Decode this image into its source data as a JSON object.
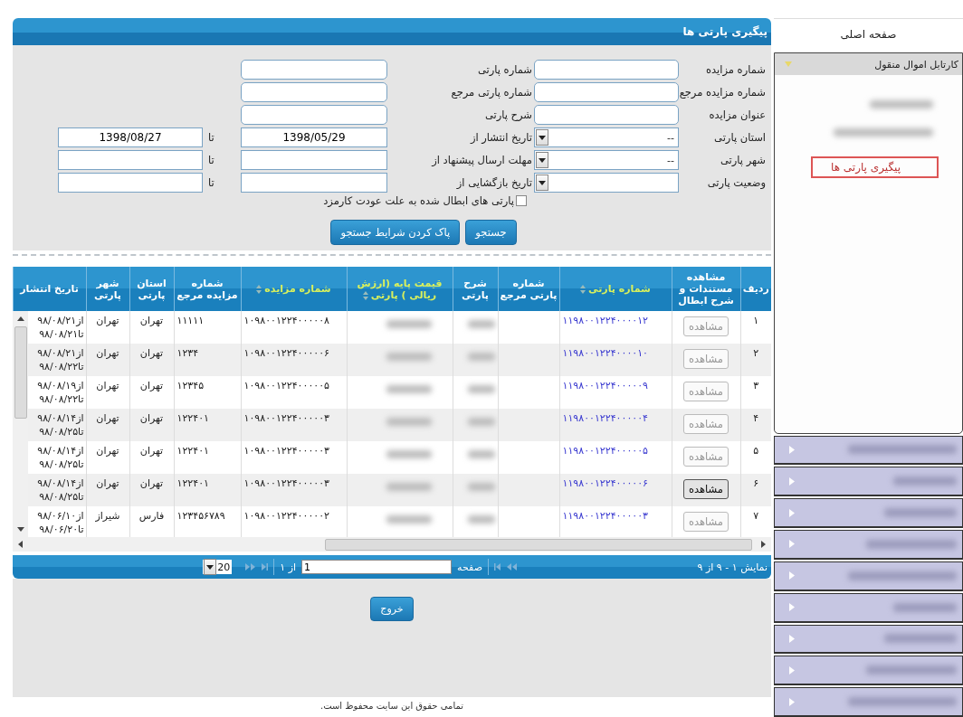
{
  "sidebar": {
    "home": "صفحه اصلی",
    "panel": {
      "title": "کارتابل اموال منقول",
      "expanded": true,
      "items": [
        {
          "kind": "blurred",
          "selected": false
        },
        {
          "kind": "blurred",
          "selected": false
        },
        {
          "kind": "link",
          "label": "پیگیری پارتی ها",
          "selected": true
        }
      ]
    },
    "collapsed_panels": [
      {
        "expanded": false
      },
      {
        "expanded": false
      },
      {
        "expanded": false
      },
      {
        "expanded": false
      },
      {
        "expanded": false
      },
      {
        "expanded": false
      },
      {
        "expanded": false
      },
      {
        "expanded": false
      },
      {
        "expanded": false
      }
    ]
  },
  "panel_title": "پیگیری پارتی ها",
  "form": {
    "column_1": [
      {
        "kind": "text",
        "label": "شماره مزایده"
      },
      {
        "kind": "text",
        "label": "شماره مزایده مرجع"
      },
      {
        "kind": "text",
        "label": "عنوان مزایده"
      },
      {
        "kind": "select",
        "label": "استان پارتی",
        "value": "--"
      },
      {
        "kind": "select",
        "label": "شهر پارتی",
        "value": "--"
      },
      {
        "kind": "select",
        "label": "وضعیت پارتی"
      }
    ],
    "column_2": [
      {
        "kind": "text",
        "label": "شماره پارتی"
      },
      {
        "kind": "text",
        "label": "شماره پارتی مرجع"
      },
      {
        "kind": "text",
        "label": "شرح پارتی"
      },
      {
        "kind": "range",
        "label": "تاریخ انتشار از",
        "from": "1398/05/29",
        "to_label": "تا",
        "to": "1398/08/27"
      },
      {
        "kind": "range",
        "label": "مهلت ارسال پیشنهاد از",
        "to_label": "تا"
      },
      {
        "kind": "range",
        "label": "تاریخ بازگشایی از",
        "to_label": "تا"
      }
    ],
    "checkbox": {
      "label": "پارتی های ابطال شده به علت عودت کارمزد",
      "checked": false
    },
    "buttons": [
      "جستجو",
      "پاک کردن شرایط جستجو"
    ]
  },
  "table": {
    "columns": [
      {
        "label": "ردیف",
        "sortable": false
      },
      {
        "label": "مشاهده مستندات و شرح ابطال",
        "sortable": false
      },
      {
        "label": "شماره پارتی",
        "sortable": true
      },
      {
        "label": "شماره پارتی مرجع",
        "sortable": false
      },
      {
        "label": "شرح پارتی",
        "sortable": false
      },
      {
        "label": "قیمت پایه (ارزش ریالی ) پارتی",
        "sortable": true
      },
      {
        "label": "شماره مزایده",
        "sortable": true
      },
      {
        "label": "شماره مزایده مرجع",
        "sortable": false
      },
      {
        "label": "استان پارتی",
        "sortable": false
      },
      {
        "label": "شهر پارتی",
        "sortable": false
      },
      {
        "label": "تاریخ انتشار",
        "sortable": false
      }
    ],
    "rows": [
      {
        "index": "۱",
        "view": {
          "label": "مشاهده",
          "focused": false
        },
        "party_no": "۱۱۹۸۰۰۱۲۲۴۰۰۰۰۱۲",
        "auction_no": "۱۰۹۸۰۰۱۲۲۴۰۰۰۰۰۸",
        "auction_ref": "۱۱۱۱۱",
        "province": "تهران",
        "city": "تهران",
        "published": [
          "از۹۸/۰۸/۲۱",
          "تا۹۸/۰۸/۲۱"
        ]
      },
      {
        "index": "۲",
        "view": {
          "label": "مشاهده",
          "focused": false
        },
        "party_no": "۱۱۹۸۰۰۱۲۲۴۰۰۰۰۱۰",
        "auction_no": "۱۰۹۸۰۰۱۲۲۴۰۰۰۰۰۶",
        "auction_ref": "۱۲۳۴",
        "province": "تهران",
        "city": "تهران",
        "published": [
          "از۹۸/۰۸/۲۱",
          "تا۹۸/۰۸/۲۲"
        ]
      },
      {
        "index": "۳",
        "view": {
          "label": "مشاهده",
          "focused": false
        },
        "party_no": "۱۱۹۸۰۰۱۲۲۴۰۰۰۰۰۹",
        "auction_no": "۱۰۹۸۰۰۱۲۲۴۰۰۰۰۰۵",
        "auction_ref": "۱۲۳۴۵",
        "province": "تهران",
        "city": "تهران",
        "published": [
          "از۹۸/۰۸/۱۹",
          "تا۹۸/۰۸/۲۲"
        ]
      },
      {
        "index": "۴",
        "view": {
          "label": "مشاهده",
          "focused": false
        },
        "party_no": "۱۱۹۸۰۰۱۲۲۴۰۰۰۰۰۴",
        "auction_no": "۱۰۹۸۰۰۱۲۲۴۰۰۰۰۰۳",
        "auction_ref": "۱۲۲۴۰۱",
        "province": "تهران",
        "city": "تهران",
        "published": [
          "از۹۸/۰۸/۱۴",
          "تا۹۸/۰۸/۲۵"
        ]
      },
      {
        "index": "۵",
        "view": {
          "label": "مشاهده",
          "focused": false
        },
        "party_no": "۱۱۹۸۰۰۱۲۲۴۰۰۰۰۰۵",
        "auction_no": "۱۰۹۸۰۰۱۲۲۴۰۰۰۰۰۳",
        "auction_ref": "۱۲۲۴۰۱",
        "province": "تهران",
        "city": "تهران",
        "published": [
          "از۹۸/۰۸/۱۴",
          "تا۹۸/۰۸/۲۵"
        ]
      },
      {
        "index": "۶",
        "view": {
          "label": "مشاهده",
          "focused": true
        },
        "party_no": "۱۱۹۸۰۰۱۲۲۴۰۰۰۰۰۶",
        "auction_no": "۱۰۹۸۰۰۱۲۲۴۰۰۰۰۰۳",
        "auction_ref": "۱۲۲۴۰۱",
        "province": "تهران",
        "city": "تهران",
        "published": [
          "از۹۸/۰۸/۱۴",
          "تا۹۸/۰۸/۲۵"
        ]
      },
      {
        "index": "۷",
        "view": {
          "label": "مشاهده",
          "focused": false
        },
        "party_no": "۱۱۹۸۰۰۱۲۲۴۰۰۰۰۰۳",
        "auction_no": "۱۰۹۸۰۰۱۲۲۴۰۰۰۰۰۲",
        "auction_ref": "۱۲۳۴۵۶۷۸۹",
        "province": "فارس",
        "city": "شیراز",
        "published": [
          "از۹۸/۰۶/۱۰",
          "تا۹۸/۰۶/۲۰"
        ]
      }
    ]
  },
  "pager": {
    "summary": "نمایش ۱ - ۹ از ۹",
    "page_label": "صفحه",
    "page": "1",
    "of": "از ۱",
    "page_size": "20"
  },
  "exit_button": "خروج",
  "footer": "تمامی حقوق این سایت محفوظ است."
}
